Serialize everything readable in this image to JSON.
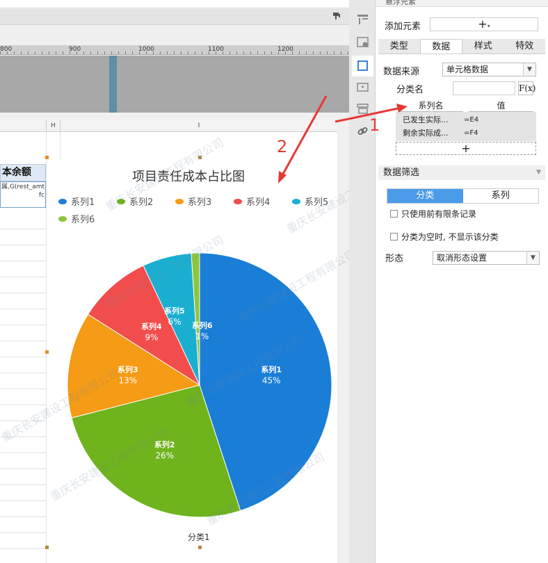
{
  "ruler": {
    "labels": [
      "800",
      "900",
      "1000",
      "1100",
      "1200"
    ]
  },
  "sheet": {
    "col_h": "H",
    "col_i": "I",
    "cell_title": "本余额",
    "cell_formula": "属,G(rest_amt fc"
  },
  "chart": {
    "title": "项目责任成本占比图",
    "category_label": "分类1"
  },
  "chart_data": {
    "type": "pie",
    "title": "项目责任成本占比图",
    "categories": [
      "系列1",
      "系列2",
      "系列3",
      "系列4",
      "系列5",
      "系列6"
    ],
    "values": [
      45,
      26,
      13,
      9,
      6,
      1
    ],
    "value_labels": [
      "45%",
      "26%",
      "13%",
      "9%",
      "6%",
      "1%"
    ],
    "colors": [
      "#1b7ed6",
      "#6fb31d",
      "#f59b15",
      "#f24d4d",
      "#1aafd1",
      "#8cc63f"
    ],
    "xlabel": "分类1",
    "legend_position": "top"
  },
  "watermark": {
    "text": "重庆长安建设工程有限公司"
  },
  "annotations": {
    "label_1": "1",
    "label_2": "2"
  },
  "panel": {
    "header": "悬浮元素",
    "add_element_label": "添加元素",
    "add_element_symbol": "+",
    "tabs": [
      {
        "label": "类型",
        "active": false
      },
      {
        "label": "数据",
        "active": true
      },
      {
        "label": "样式",
        "active": false
      },
      {
        "label": "特效",
        "active": false
      }
    ],
    "data_source_label": "数据来源",
    "data_source_value": "单元格数据",
    "category_name_label": "分类名",
    "fx_label": "F(x)",
    "series_header_name": "系列名",
    "series_header_value": "值",
    "series_rows": [
      {
        "name": "已发生实际...",
        "value": "=E4"
      },
      {
        "name": "剩余实际成...",
        "value": "=F4"
      }
    ],
    "add_series_symbol": "+",
    "filter_section_label": "数据筛选",
    "filter_toggle": [
      "分类",
      "系列"
    ],
    "only_first_records_label": "只使用前有限条记录",
    "hide_empty_category_label": "分类为空时, 不显示该分类",
    "shape_label": "形态",
    "shape_value": "取消形态设置"
  }
}
